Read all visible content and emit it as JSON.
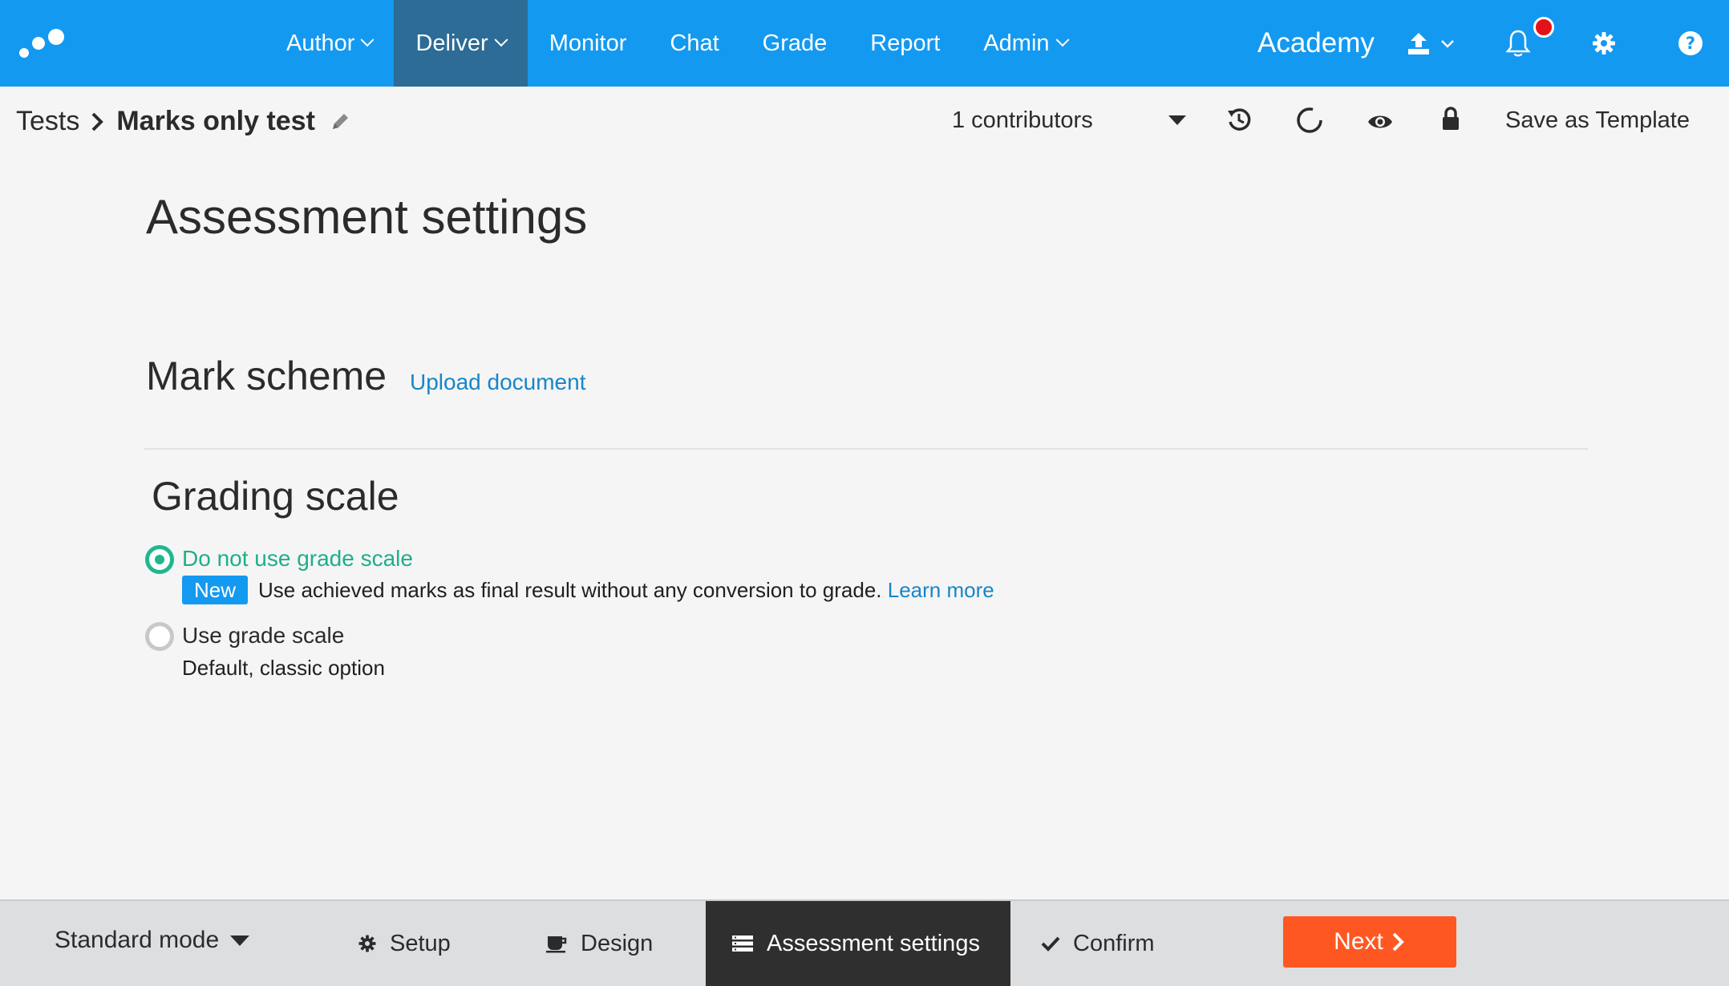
{
  "nav": {
    "items": [
      {
        "label": "Author",
        "dropdown": true,
        "active": false
      },
      {
        "label": "Deliver",
        "dropdown": true,
        "active": true
      },
      {
        "label": "Monitor",
        "dropdown": false,
        "active": false
      },
      {
        "label": "Chat",
        "dropdown": false,
        "active": false
      },
      {
        "label": "Grade",
        "dropdown": false,
        "active": false
      },
      {
        "label": "Report",
        "dropdown": false,
        "active": false
      },
      {
        "label": "Admin",
        "dropdown": true,
        "active": false
      }
    ],
    "org_name": "Academy",
    "icons": [
      "upload-icon",
      "bell-icon",
      "gear-icon",
      "help-icon"
    ],
    "colors": {
      "nav_bg": "#1499f0",
      "nav_active": "#2c6c96",
      "notification": "#e5121a"
    }
  },
  "breadcrumb": {
    "parent": "Tests",
    "current": "Marks only test"
  },
  "toolbar": {
    "contributors": "1 contributors",
    "save_template": "Save as Template"
  },
  "main": {
    "title": "Assessment settings",
    "mark_scheme": {
      "heading": "Mark scheme",
      "upload_link": "Upload document"
    },
    "grading": {
      "heading": "Grading scale",
      "options": [
        {
          "label": "Do not use grade scale",
          "selected": true,
          "badge": "New",
          "description": "Use achieved marks as final result without any conversion to grade.",
          "link": "Learn more"
        },
        {
          "label": "Use grade scale",
          "selected": false,
          "description": "Default, classic option"
        }
      ]
    },
    "colors": {
      "accent_green": "#1fb790",
      "link_blue": "#1786c8"
    }
  },
  "footer": {
    "mode": "Standard mode",
    "steps": [
      {
        "label": "Setup",
        "icon": "gear-icon",
        "active": false
      },
      {
        "label": "Design",
        "icon": "cup-icon",
        "active": false
      },
      {
        "label": "Assessment settings",
        "icon": "list-icon",
        "active": true
      },
      {
        "label": "Confirm",
        "icon": "check-icon",
        "active": false
      }
    ],
    "next": "Next",
    "colors": {
      "next_bg": "#ff5722",
      "active_step_bg": "#2f2f2f"
    }
  }
}
